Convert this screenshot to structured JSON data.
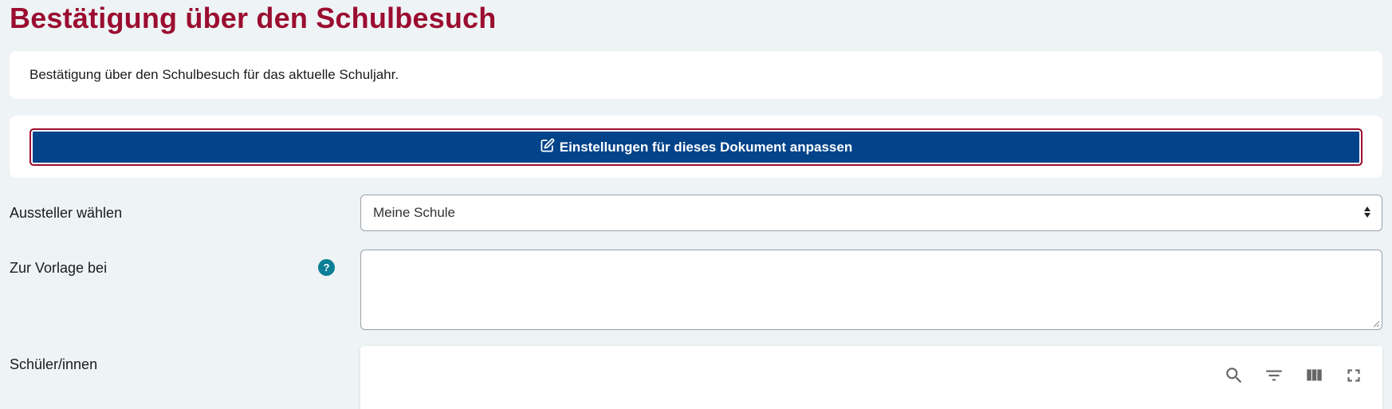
{
  "page": {
    "title": "Bestätigung über den Schulbesuch"
  },
  "info": {
    "text": "Bestätigung über den Schulbesuch für das aktuelle Schuljahr."
  },
  "settings_button": {
    "label": "Einstellungen für dieses Dokument anpassen",
    "icon": "edit-icon"
  },
  "form": {
    "issuer": {
      "label": "Aussteller wählen",
      "selected": "Meine Schule"
    },
    "submit_to": {
      "label": "Zur Vorlage bei",
      "value": "",
      "help_glyph": "?"
    },
    "students": {
      "label": "Schüler/innen",
      "toolbar": [
        "search-icon",
        "filter-icon",
        "columns-icon",
        "fullscreen-icon"
      ]
    }
  },
  "colors": {
    "title": "#9b0d30",
    "button_bg": "#02438a",
    "button_border": "#9b0d30",
    "help_icon": "#0b7f95",
    "background": "#eef3f5"
  }
}
